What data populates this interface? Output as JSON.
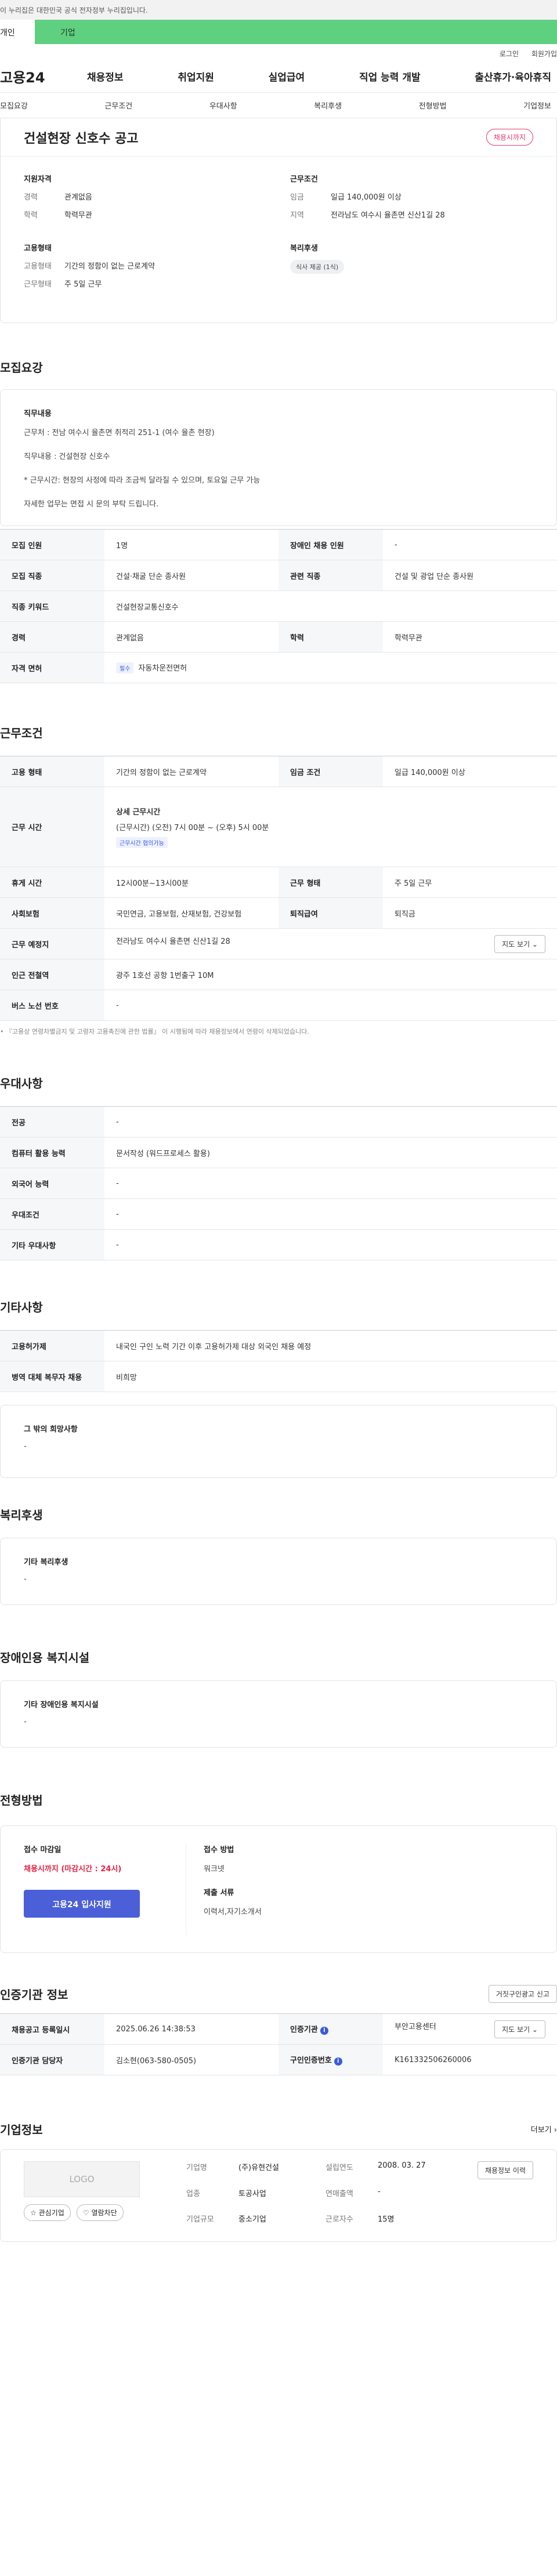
{
  "notice": "이 누리집은 대한민국 공식 전자정부 누리집입니다.",
  "service_tabs": [
    "개인",
    "기업"
  ],
  "util": [
    "로그인",
    "회원가입"
  ],
  "logo": "고용24",
  "gnb": [
    "채용정보",
    "취업지원",
    "실업급여",
    "직업 능력 개발",
    "출산휴가·육아휴직"
  ],
  "subnav": [
    "모집요강",
    "근무조건",
    "우대사항",
    "복리후생",
    "전형방법",
    "기업정보"
  ],
  "summary": {
    "title": "건설현장 신호수 공고",
    "status": "채용시까지",
    "qual_title": "지원자격",
    "career_k": "경력",
    "career_v": "관계없음",
    "edu_k": "학력",
    "edu_v": "학력무관",
    "work_title": "근무조건",
    "wage_k": "임금",
    "wage_v": "일급 140,000원 이상",
    "loc_k": "지역",
    "loc_v": "전라남도 여수시 율촌면 신산1길 28",
    "emp_title": "고용형태",
    "emp_k": "고용형태",
    "emp_v": "기간의 정함이 없는 근로계약",
    "form_k": "근무형태",
    "form_v": "주 5일 근무",
    "welfare_title": "복리후생",
    "welfare_chip": "식사 제공 (1식)"
  },
  "recruit": {
    "title": "모집요강",
    "duty_title": "직무내용",
    "lines": [
      "근무처 : 전남 여수시 율촌면 취적리 251-1 (여수 율촌 현장)",
      "직무내용 : 건설현장 신호수",
      "* 근무시간: 현장의 사정에 따라 조금씩 달라질 수 있으며, 토요일 근무 가능",
      "자세한 업무는 면접 시 문의 부탁 드립니다."
    ],
    "rows": {
      "headcount_k": "모집 인원",
      "headcount_v": "1명",
      "disabled_k": "장애인 채용 인원",
      "disabled_v": "-",
      "job_k": "모집 직종",
      "job_v": "건설·채굴 단순 종사원",
      "rel_k": "관련 직종",
      "rel_v": "건설 및 광업 단순 종사원",
      "kw_k": "직종 키워드",
      "kw_v": "건설현장교통신호수",
      "car_k": "경력",
      "car_v": "관계없음",
      "edu_k": "학력",
      "edu_v": "학력무관",
      "lic_k": "자격 면허",
      "lic_badge": "필수",
      "lic_v": "자동차운전면허"
    }
  },
  "conditions": {
    "title": "근무조건",
    "type_k": "고용 형태",
    "type_v": "기간의 정함이 없는 근로계약",
    "wage_k": "임금 조건",
    "wage_v": "일급 140,000원 이상",
    "time_k": "근무 시간",
    "time_title": "상세 근무시간",
    "time_v": "(근무시간) (오전) 7시 00분 ~ (오후) 5시 00분",
    "time_badge": "근무시간 협의가능",
    "break_k": "휴게 시간",
    "break_v": "12시00분~13시00분",
    "form_k": "근무 형태",
    "form_v": "주 5일 근무",
    "ins_k": "사회보험",
    "ins_v": "국민연금, 고용보험, 산재보험, 건강보험",
    "ret_k": "퇴직급여",
    "ret_v": "퇴직금",
    "loc_k": "근무 예정지",
    "loc_v": "전라남도 여수시 율촌면 신산1길 28",
    "map_btn": "지도 보기 ⌄",
    "subway_k": "인근 전철역",
    "subway_v": "광주 1호선 공항 1번출구 10M",
    "bus_k": "버스 노선 번호",
    "bus_v": "-",
    "footnote": "• 『고용상 연령차별금지 및 고령자 고용촉진에 관한 법률』 이 시행됨에 따라 채용정보에서 연령이 삭제되었습니다."
  },
  "prefer": {
    "title": "우대사항",
    "major_k": "전공",
    "major_v": "-",
    "pc_k": "컴퓨터 활용 능력",
    "pc_v": "문서작성 (워드프로세스 활용)",
    "lang_k": "외국어 능력",
    "lang_v": "-",
    "cond_k": "우대조건",
    "cond_v": "-",
    "etc_k": "기타 우대사항",
    "etc_v": "-"
  },
  "other": {
    "title": "기타사항",
    "visa_k": "고용허가제",
    "visa_v": "내국인 구인 노력 기간 이후 고용허가제 대상 외국인 채용 예정",
    "mil_k": "병역 대체 복무자 채용",
    "mil_v": "비희망",
    "extra_title": "그 밖의 희망사항",
    "extra_v": "-"
  },
  "welfare": {
    "title": "복리후생",
    "box_title": "기타 복리후생",
    "box_v": "-"
  },
  "disabled": {
    "title": "장애인용 복지시설",
    "box_title": "기타 장애인용 복지시설",
    "box_v": "-"
  },
  "selection": {
    "title": "전형방법",
    "deadline_title": "접수 마감일",
    "deadline_v": "채용시까지 (마감시간 : 24시)",
    "apply_btn": "고용24 입사지원",
    "method_title": "접수 방법",
    "method_v": "워크넷",
    "docs_title": "제출 서류",
    "docs_v": "이력서,자기소개서"
  },
  "cert": {
    "title": "인증기관 정보",
    "report_btn": "거짓구인광고 신고",
    "reg_k": "채용공고 등록일시",
    "reg_v": "2025.06.26 14:38:53",
    "org_k": "인증기관",
    "org_v": "부안고용센터",
    "map_btn": "지도 보기 ⌄",
    "mgr_k": "인증기관 담당자",
    "mgr_v": "김소현(063-580-0505)",
    "auth_k": "구인인증번호",
    "auth_v": "K161332506260006"
  },
  "company": {
    "title": "기업정보",
    "more": "더보기 ›",
    "logo": "LOGO",
    "fav_btn": "☆ 관심기업",
    "follow_btn": "♡ 열람차단",
    "name_k": "기업명",
    "name_v": "(주)유현건설",
    "year_k": "설립연도",
    "year_v": "2008. 03. 27",
    "history_btn": "채용정보 이력",
    "ind_k": "업종",
    "ind_v": "토공사업",
    "sales_k": "연매출액",
    "sales_v": "-",
    "size_k": "기업규모",
    "size_v": "중소기업",
    "emp_k": "근로자수",
    "emp_v": "15명"
  }
}
